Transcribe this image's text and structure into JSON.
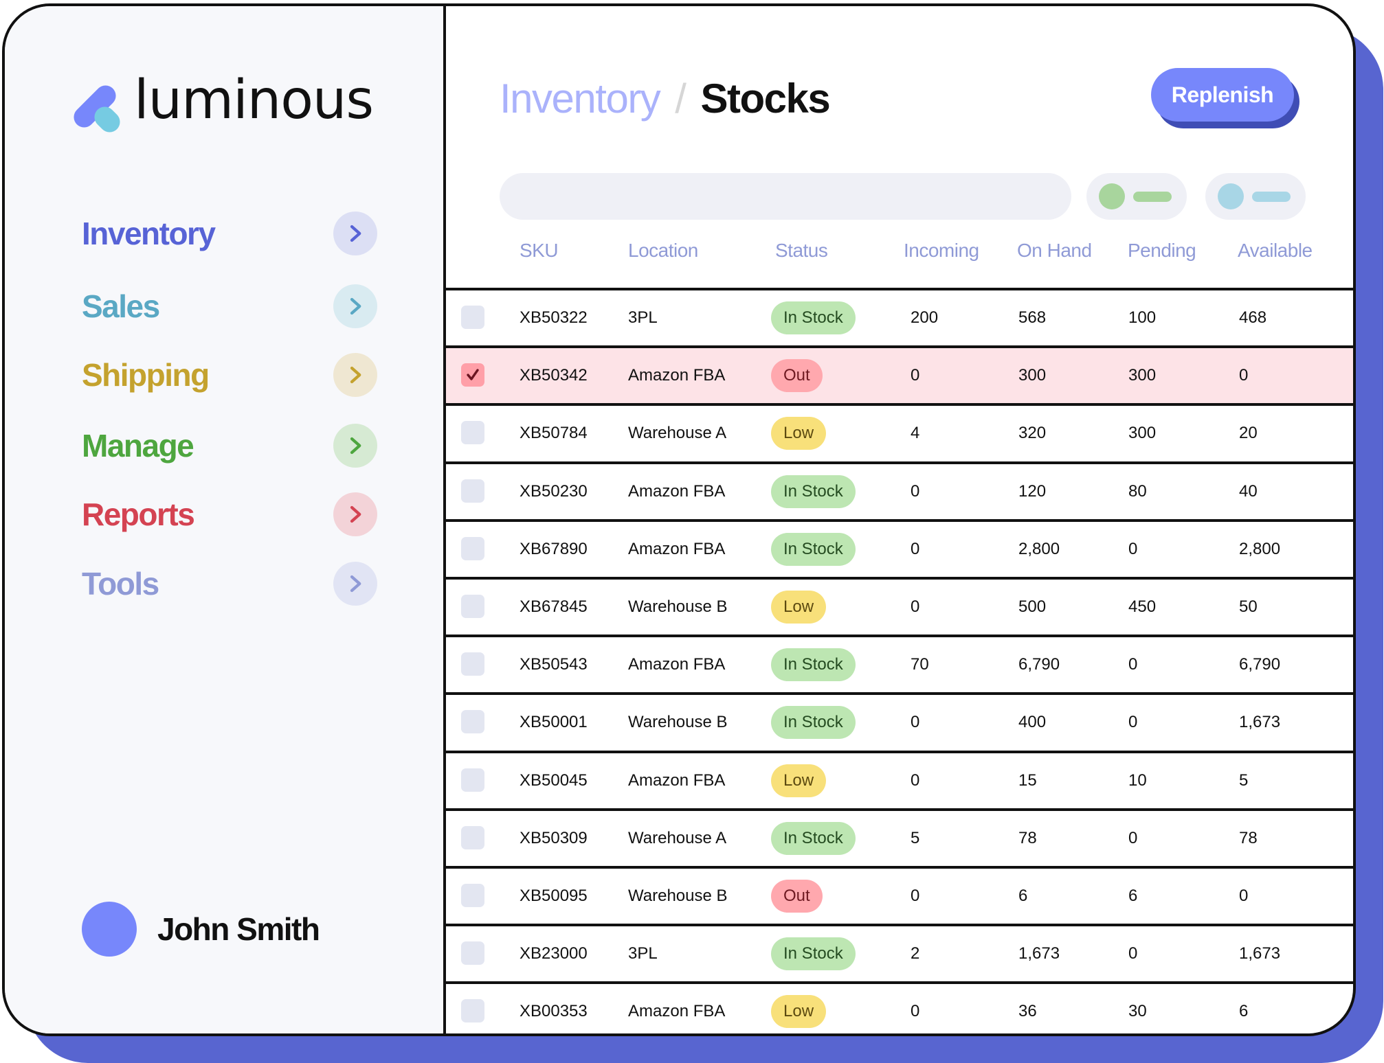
{
  "brand": {
    "name": "luminous"
  },
  "sidebar": {
    "items": [
      {
        "label": "Inventory",
        "color": "#5763d6",
        "bg": "#dcdff4",
        "icon": "chevron-right-icon"
      },
      {
        "label": "Sales",
        "color": "#5aa8c4",
        "bg": "#d9ebf1",
        "icon": "chevron-right-icon"
      },
      {
        "label": "Shipping",
        "color": "#c4a22e",
        "bg": "#efe7d2",
        "icon": "chevron-right-icon"
      },
      {
        "label": "Manage",
        "color": "#4ea63f",
        "bg": "#d6ead3",
        "icon": "chevron-right-icon"
      },
      {
        "label": "Reports",
        "color": "#d44352",
        "bg": "#f3d3d8",
        "icon": "chevron-right-icon"
      },
      {
        "label": "Tools",
        "color": "#8f9ad6",
        "bg": "#e1e4f4",
        "icon": "chevron-right-icon"
      }
    ],
    "user": {
      "name": "John Smith"
    }
  },
  "header": {
    "breadcrumb": {
      "parent": "Inventory",
      "separator": "/",
      "current": "Stocks"
    },
    "replenish_label": "Replenish"
  },
  "filters": {
    "search_placeholder": "",
    "chips": [
      {
        "name": "green-filter",
        "color": "#a8d59d"
      },
      {
        "name": "blue-filter",
        "color": "#a8d6e6"
      }
    ]
  },
  "table": {
    "columns": [
      "SKU",
      "Location",
      "Status",
      "Incoming",
      "On Hand",
      "Pending",
      "Available"
    ],
    "rows": [
      {
        "selected": false,
        "sku": "XB50322",
        "location": "3PL",
        "status": "In Stock",
        "incoming": "200",
        "on_hand": "568",
        "pending": "100",
        "available": "468"
      },
      {
        "selected": true,
        "sku": "XB50342",
        "location": "Amazon FBA",
        "status": "Out",
        "incoming": "0",
        "on_hand": "300",
        "pending": "300",
        "available": "0"
      },
      {
        "selected": false,
        "sku": "XB50784",
        "location": "Warehouse A",
        "status": "Low",
        "incoming": "4",
        "on_hand": "320",
        "pending": "300",
        "available": "20"
      },
      {
        "selected": false,
        "sku": "XB50230",
        "location": "Amazon FBA",
        "status": "In Stock",
        "incoming": "0",
        "on_hand": "120",
        "pending": "80",
        "available": "40"
      },
      {
        "selected": false,
        "sku": "XB67890",
        "location": "Amazon FBA",
        "status": "In Stock",
        "incoming": "0",
        "on_hand": "2,800",
        "pending": "0",
        "available": "2,800"
      },
      {
        "selected": false,
        "sku": "XB67845",
        "location": "Warehouse B",
        "status": "Low",
        "incoming": "0",
        "on_hand": "500",
        "pending": "450",
        "available": "50"
      },
      {
        "selected": false,
        "sku": "XB50543",
        "location": "Amazon FBA",
        "status": "In Stock",
        "incoming": "70",
        "on_hand": "6,790",
        "pending": "0",
        "available": "6,790"
      },
      {
        "selected": false,
        "sku": "XB50001",
        "location": "Warehouse B",
        "status": "In Stock",
        "incoming": "0",
        "on_hand": "400",
        "pending": "0",
        "available": "1,673"
      },
      {
        "selected": false,
        "sku": "XB50045",
        "location": "Amazon FBA",
        "status": "Low",
        "incoming": "0",
        "on_hand": "15",
        "pending": "10",
        "available": "5"
      },
      {
        "selected": false,
        "sku": "XB50309",
        "location": "Warehouse A",
        "status": "In Stock",
        "incoming": "5",
        "on_hand": "78",
        "pending": "0",
        "available": "78"
      },
      {
        "selected": false,
        "sku": "XB50095",
        "location": "Warehouse B",
        "status": "Out",
        "incoming": "0",
        "on_hand": "6",
        "pending": "6",
        "available": "0"
      },
      {
        "selected": false,
        "sku": "XB23000",
        "location": "3PL",
        "status": "In Stock",
        "incoming": "2",
        "on_hand": "1,673",
        "pending": "0",
        "available": "1,673"
      },
      {
        "selected": false,
        "sku": "XB00353",
        "location": "Amazon FBA",
        "status": "Low",
        "incoming": "0",
        "on_hand": "36",
        "pending": "30",
        "available": "6"
      }
    ]
  },
  "colors": {
    "accent": "#7787fb",
    "accent_dark": "#3f4db5",
    "frame_shadow": "#5865d0",
    "selected_row": "#fde3e7",
    "status_in_stock": "#bde6b2",
    "status_out": "#ffa8ae",
    "status_low": "#f8e07a"
  }
}
